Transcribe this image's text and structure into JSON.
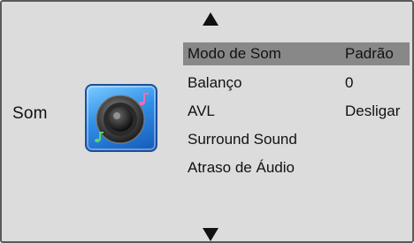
{
  "category": {
    "label": "Som",
    "icon": "speaker-icon"
  },
  "navigation": {
    "up_icon": "triangle-up-icon",
    "down_icon": "triangle-down-icon"
  },
  "menu": {
    "selected_index": 0,
    "items": [
      {
        "label": "Modo de Som",
        "value": "Padrão"
      },
      {
        "label": "Balanço",
        "value": "0"
      },
      {
        "label": "AVL",
        "value": "Desligar"
      },
      {
        "label": "Surround Sound",
        "value": ""
      },
      {
        "label": "Atraso de Áudio",
        "value": ""
      }
    ]
  },
  "colors": {
    "panel_background": "#dcdcdc",
    "selection_highlight": "#888888",
    "icon_blue": "#2f8fe8"
  }
}
